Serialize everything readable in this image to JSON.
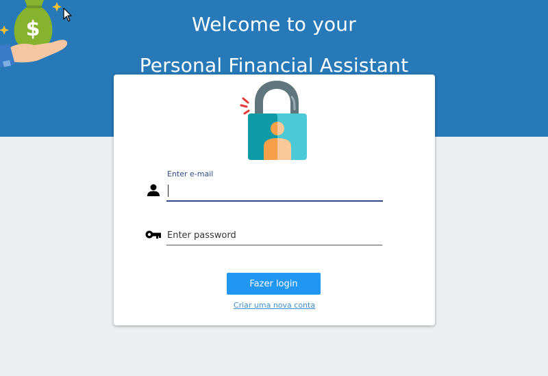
{
  "header": {
    "title_line_1": "Welcome to your",
    "title_line_2": "Personal Financial Assistant",
    "background_color": "#2879b8",
    "logo_icon": "money-bag-hand-icon"
  },
  "card": {
    "lock_icon": "lock-user-icon",
    "email": {
      "icon": "person-icon",
      "label": "Enter e-mail",
      "value": ""
    },
    "password": {
      "icon": "key-icon",
      "placeholder": "Enter password",
      "value": ""
    },
    "login_button_label": "Fazer login",
    "create_account_link": "Criar uma nova conta",
    "accent_color": "#2196f3",
    "link_color": "#3b8fd0"
  },
  "page": {
    "background_color": "#eceff1"
  }
}
